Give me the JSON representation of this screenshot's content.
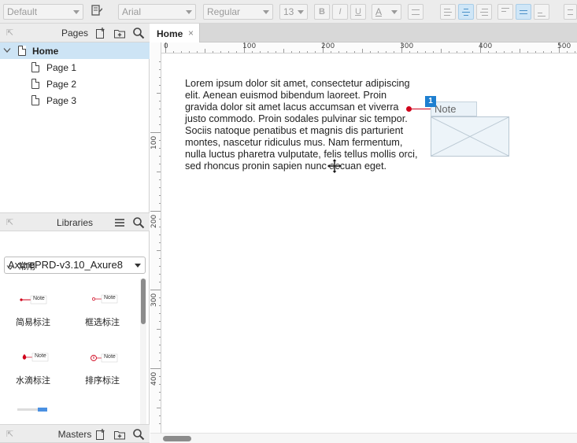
{
  "toolbar": {
    "style_dropdown": "Default",
    "font_family": "Arial",
    "font_weight": "Regular",
    "font_size": "13",
    "bold_label": "B",
    "italic_label": "I",
    "underline_label": "U",
    "text_color_label": "A"
  },
  "pages_panel": {
    "title": "Pages",
    "collapse_glyph": "⇱",
    "tree": [
      {
        "label": "Home",
        "selected": true
      },
      {
        "label": "Page 1"
      },
      {
        "label": "Page 2"
      },
      {
        "label": "Page 3"
      }
    ]
  },
  "libraries_panel": {
    "title": "Libraries",
    "collapse_glyph": "⇱",
    "selected_library": "AxurePRD-v3.10_Axure8",
    "group_label": "常用",
    "items": [
      {
        "name": "简易标注",
        "thumb_text": "Note"
      },
      {
        "name": "框选标注",
        "thumb_text": "Note"
      },
      {
        "name": "水滴标注",
        "thumb_text": "Note"
      },
      {
        "name": "排序标注",
        "thumb_text": "Note"
      }
    ]
  },
  "masters_panel": {
    "title": "Masters",
    "collapse_glyph": "⇱"
  },
  "editor": {
    "tab_label": "Home",
    "tab_close": "×",
    "ruler_h_labels": [
      "0",
      "100",
      "200",
      "300",
      "400",
      "500"
    ],
    "ruler_v_labels": [
      "100",
      "200",
      "300",
      "400"
    ],
    "lorem_text": "Lorem ipsum dolor sit amet, consectetur adipiscing elit. Aenean euismod bibendum laoreet. Proin gravida dolor sit amet lacus accumsan et viverra justo commodo. Proin sodales pulvinar sic tempor. Sociis natoque penatibus et magnis dis parturient montes, nascetur ridiculus mus. Nam fermentum, nulla luctus pharetra vulputate, felis tellus mollis orci, sed rhoncus pronin sapien nunc accuan eget.",
    "note_number": "1",
    "note_label": "Note"
  },
  "colors": {
    "selection_bg": "#cde4f5",
    "note_accent": "#d0021b",
    "note_badge": "#1e7fd0"
  }
}
